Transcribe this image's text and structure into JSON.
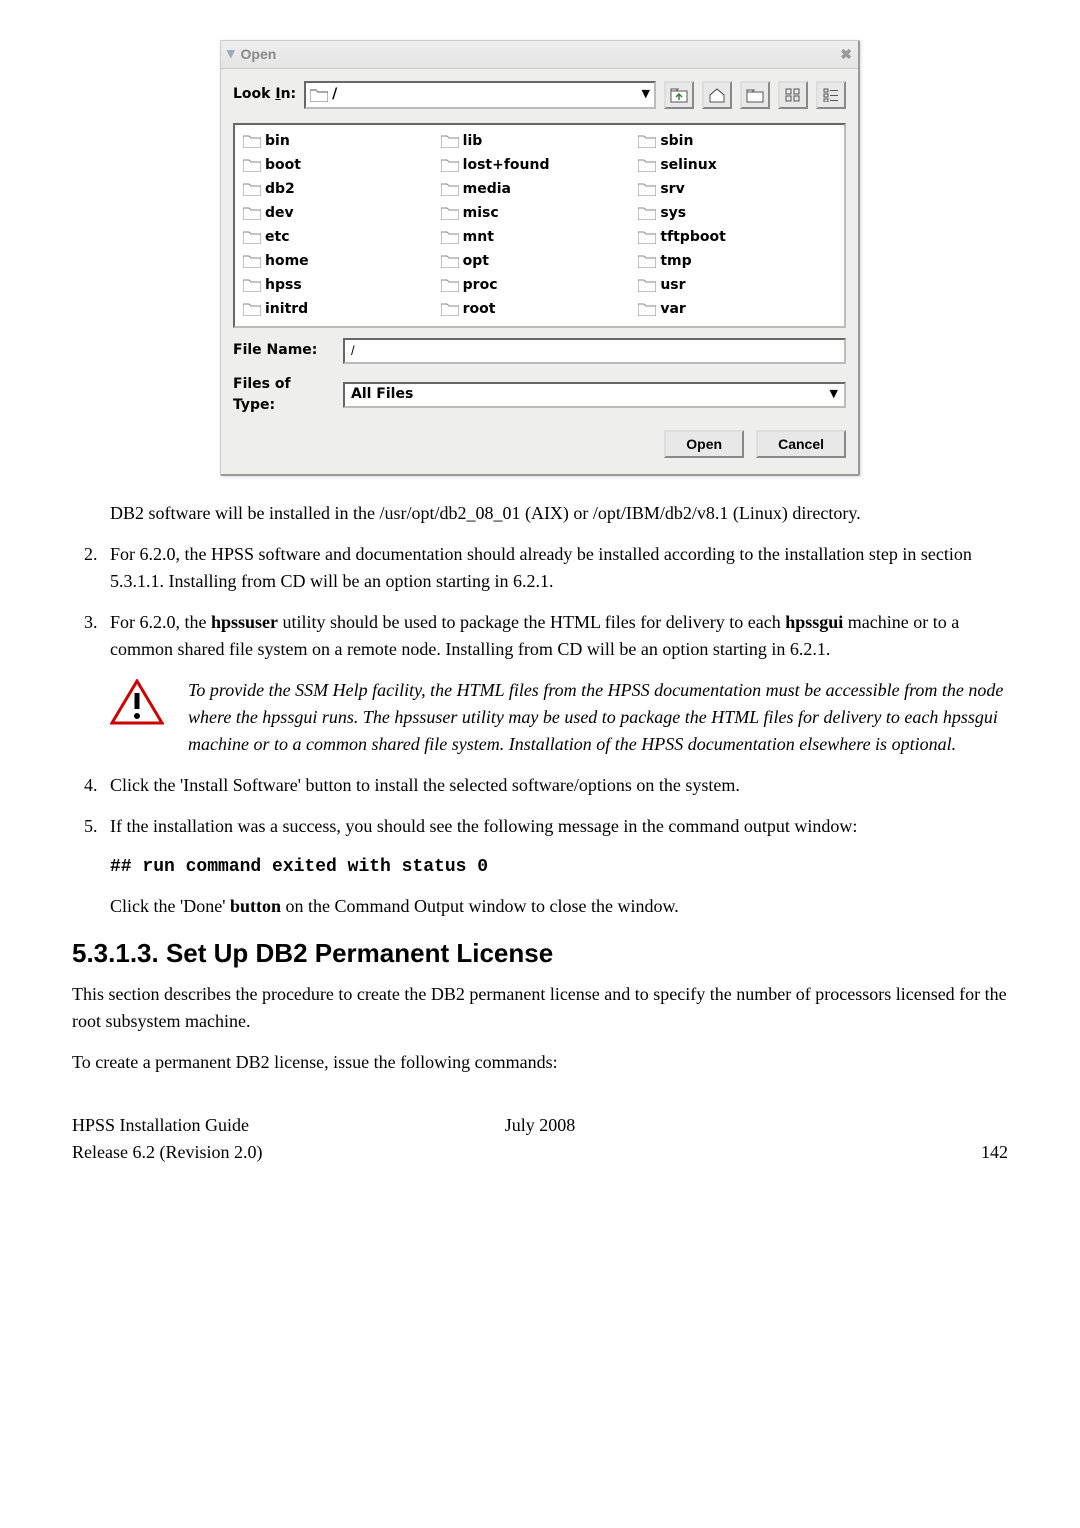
{
  "dialog": {
    "title": "Open",
    "look_in_label": "Look In:",
    "look_in_value": "/",
    "files": [
      [
        "bin",
        "lib",
        "sbin"
      ],
      [
        "boot",
        "lost+found",
        "selinux"
      ],
      [
        "db2",
        "media",
        "srv"
      ],
      [
        "dev",
        "misc",
        "sys"
      ],
      [
        "etc",
        "mnt",
        "tftpboot"
      ],
      [
        "home",
        "opt",
        "tmp"
      ],
      [
        "hpss",
        "proc",
        "usr"
      ],
      [
        "initrd",
        "root",
        "var"
      ]
    ],
    "file_name_label": "File Name:",
    "file_name_value": "/",
    "files_of_type_label": "Files of Type:",
    "files_of_type_value": "All Files",
    "open_btn": "Open",
    "cancel_btn": "Cancel"
  },
  "doc": {
    "db2_para": "DB2 software will be installed in the /usr/opt/db2_08_01 (AIX) or /opt/IBM/db2/v8.1 (Linux) directory.",
    "item2": "For 6.2.0, the HPSS software and documentation should already be installed according to the installation step in section 5.3.1.1.  Installing from CD will be an option starting in 6.2.1.",
    "item3_a": "For 6.2.0, the ",
    "item3_b": "hpssuser",
    "item3_c": " utility should be used to package the HTML files for delivery to each ",
    "item3_d": "hpssgui",
    "item3_e": " machine or to a common shared file system on a remote node.  Installing from CD will be an option starting in 6.2.1.",
    "note": "To provide the SSM Help facility, the HTML files from the HPSS documentation must be accessible from the node where the hpssgui runs. The hpssuser utility may be used to package the HTML files for delivery to each hpssgui machine or to a common shared file system.  Installation of the HPSS documentation elsewhere is optional.",
    "item4": "Click the 'Install Software' button to install the selected software/options on the system.",
    "item5": "If the installation was a success, you should see the following message in the command output window:",
    "code_line": "## run command exited with status 0",
    "item5_after_a": "Click the 'Done' ",
    "item5_after_b": "button",
    "item5_after_c": " on the Command Output window to close the window.",
    "section_heading": "5.3.1.3.  Set Up DB2 Permanent License",
    "section_p1": "This section describes the  procedure to create the DB2 permanent license and to specify the number of processors licensed for the root subsystem machine.",
    "section_p2": "To create a permanent DB2 license, issue the following commands:",
    "footer_l1": "HPSS Installation Guide",
    "footer_l2": "Release 6.2 (Revision 2.0)",
    "footer_c": "July 2008",
    "footer_r": "142"
  }
}
